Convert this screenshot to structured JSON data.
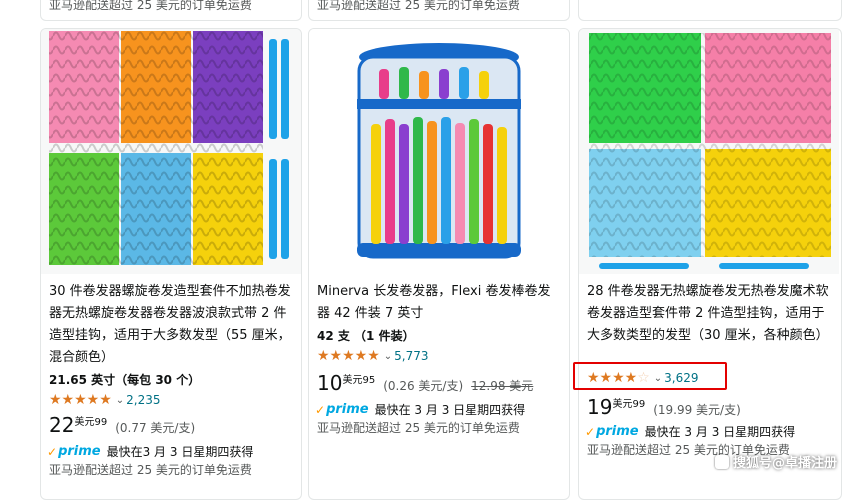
{
  "top_strip": {
    "card1_text": "亚马逊配送超过 25 美元的订单免运费",
    "card2_text": "亚马逊配送超过 25 美元的订单免运费"
  },
  "products": [
    {
      "title": "30 件卷发器螺旋卷发造型套件不加热卷发器无热螺旋卷发器卷发器波浪款式带 2 件造型挂钩，适用于大多数发型（55 厘米，混合颜色）",
      "size": "21.65 英寸（每包 30 个）",
      "rating": 4.5,
      "rating_count": "2,235",
      "price_whole": "22",
      "price_unit": "美元",
      "price_frac": "99",
      "unit_price": "(0.77 美元/支)",
      "list_price": "",
      "prime_label": "prime",
      "delivery": "最快在3 月 3 日星期四获得",
      "shipping": "亚马逊配送超过 25 美元的订单免运费"
    },
    {
      "title": "Minerva 长发卷发器，Flexi 卷发棒卷发器 42 件装 7 英寸",
      "size": "42 支 （1 件装）",
      "rating": 4.5,
      "rating_count": "5,773",
      "price_whole": "10",
      "price_unit": "美元",
      "price_frac": "95",
      "unit_price": "(0.26 美元/支)",
      "list_price": "12.98 美元",
      "prime_label": "prime",
      "delivery": "最快在 3 月 3 日星期四获得",
      "shipping": "亚马逊配送超过 25 美元的订单免运费"
    },
    {
      "title": "28 件卷发器无热螺旋卷发无热卷发魔术软卷发器造型套件带 2 件造型挂钩，适用于大多数类型的发型（30 厘米，各种颜色）",
      "size": "",
      "rating": 4,
      "rating_count": "3,629",
      "price_whole": "19",
      "price_unit": "美元",
      "price_frac": "99",
      "unit_price": "(19.99 美元/支)",
      "list_price": "",
      "prime_label": "prime",
      "delivery": "最快在 3 月 3 日星期四获得",
      "shipping": "亚马逊配送超过 25 美元的订单免运费"
    }
  ],
  "watermark": "搜狐号@卓播注册",
  "colors": {
    "star": "#de7921",
    "link": "#007185",
    "prime_blue": "#00a8e1",
    "prime_check": "#ff9900",
    "highlight": "#e30000"
  }
}
